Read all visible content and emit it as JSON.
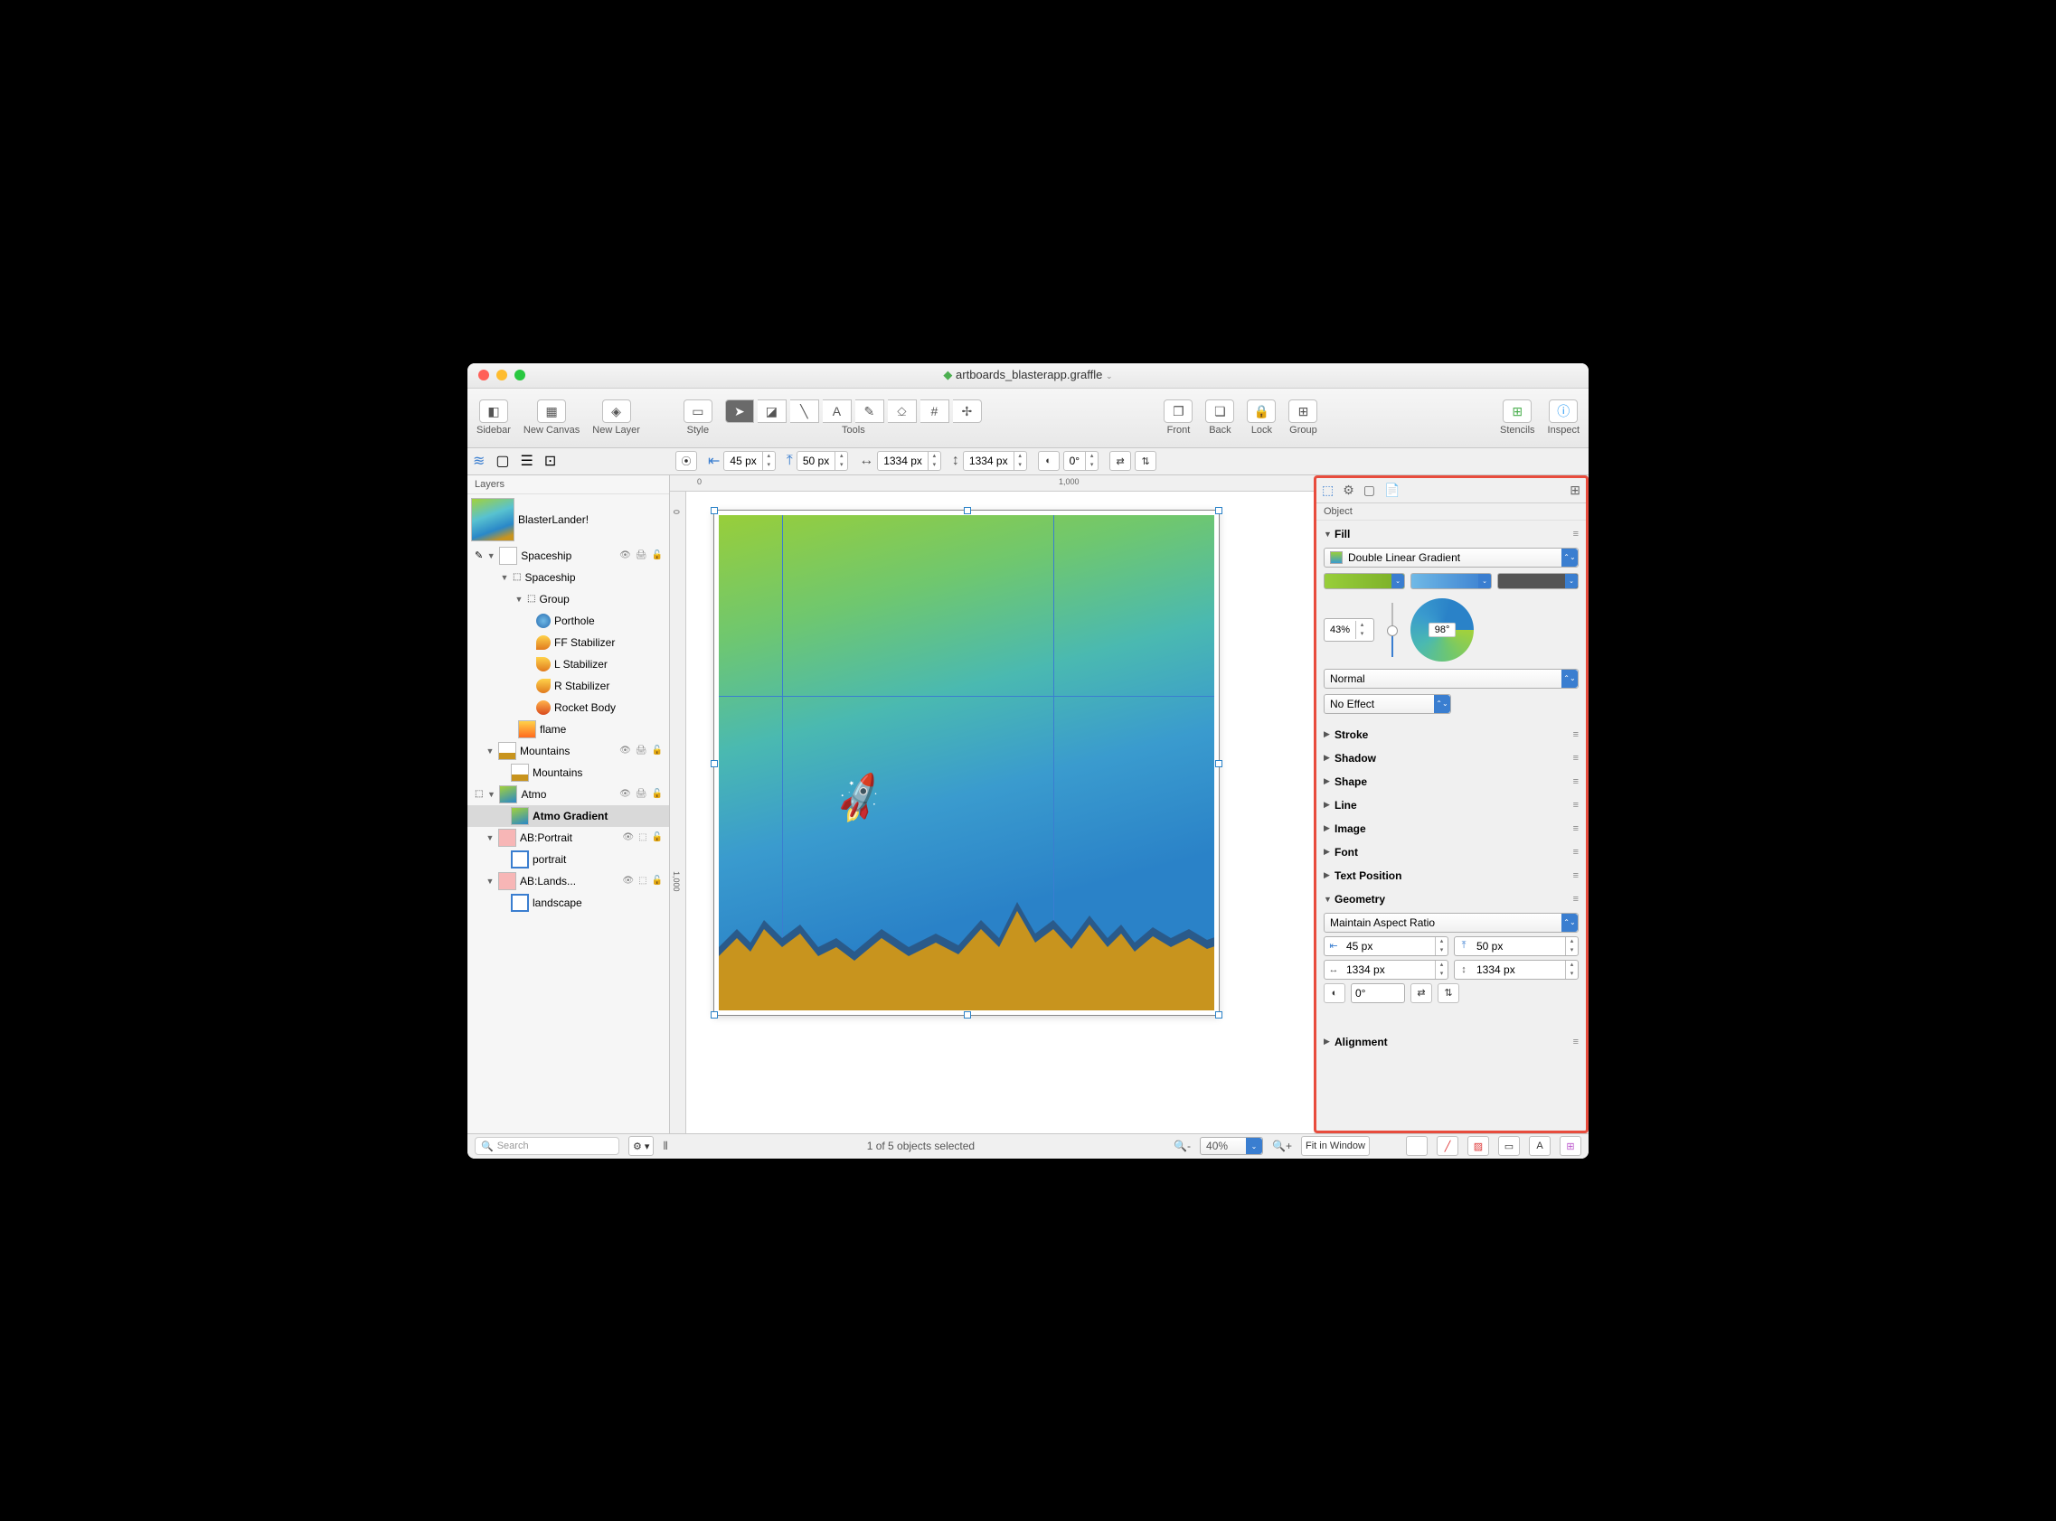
{
  "window": {
    "title": "artboards_blasterapp.graffle"
  },
  "toolbar": {
    "sidebar": "Sidebar",
    "new_canvas": "New Canvas",
    "new_layer": "New Layer",
    "style": "Style",
    "tools": "Tools",
    "front": "Front",
    "back": "Back",
    "lock": "Lock",
    "group": "Group",
    "stencils": "Stencils",
    "inspect": "Inspect"
  },
  "infobar": {
    "x": "45 px",
    "y": "50 px",
    "w": "1334 px",
    "h": "1334 px",
    "rotation": "0°"
  },
  "sidebar": {
    "title": "Layers",
    "canvas": "BlasterLander!",
    "layers": [
      {
        "name": "Spaceship",
        "children": [
          {
            "name": "Spaceship",
            "type": "group",
            "children": [
              {
                "name": "Group",
                "type": "group",
                "children": [
                  {
                    "name": "Porthole"
                  },
                  {
                    "name": "FF Stabilizer"
                  },
                  {
                    "name": "L Stabilizer"
                  },
                  {
                    "name": "R Stabilizer"
                  },
                  {
                    "name": "Rocket Body"
                  }
                ]
              },
              {
                "name": "flame"
              }
            ]
          }
        ]
      },
      {
        "name": "Mountains",
        "children": [
          {
            "name": "Mountains"
          }
        ]
      },
      {
        "name": "Atmo",
        "children": [
          {
            "name": "Atmo Gradient",
            "selected": true
          }
        ]
      },
      {
        "name": "AB:Portrait",
        "children": [
          {
            "name": "portrait"
          }
        ]
      },
      {
        "name": "AB:Lands...",
        "full": "AB:Landscape",
        "children": [
          {
            "name": "landscape"
          }
        ]
      }
    ]
  },
  "inspector": {
    "tab": "Object",
    "fill": {
      "label": "Fill",
      "type": "Double Linear Gradient",
      "color1": "#98ce3a",
      "color2": "#3a9bce",
      "color3": "#555555",
      "midpoint": "43%",
      "angle": "98°",
      "blend": "Normal",
      "effect": "No Effect"
    },
    "sections": [
      "Stroke",
      "Shadow",
      "Shape",
      "Line",
      "Image",
      "Font",
      "Text Position"
    ],
    "geometry": {
      "label": "Geometry",
      "aspect": "Maintain Aspect Ratio",
      "x": "45 px",
      "y": "50 px",
      "w": "1334 px",
      "h": "1334 px",
      "rot": "0°"
    },
    "alignment": "Alignment"
  },
  "status": {
    "search_placeholder": "Search",
    "selection": "1 of 5 objects selected",
    "zoom": "40%",
    "fit": "Fit in Window"
  }
}
